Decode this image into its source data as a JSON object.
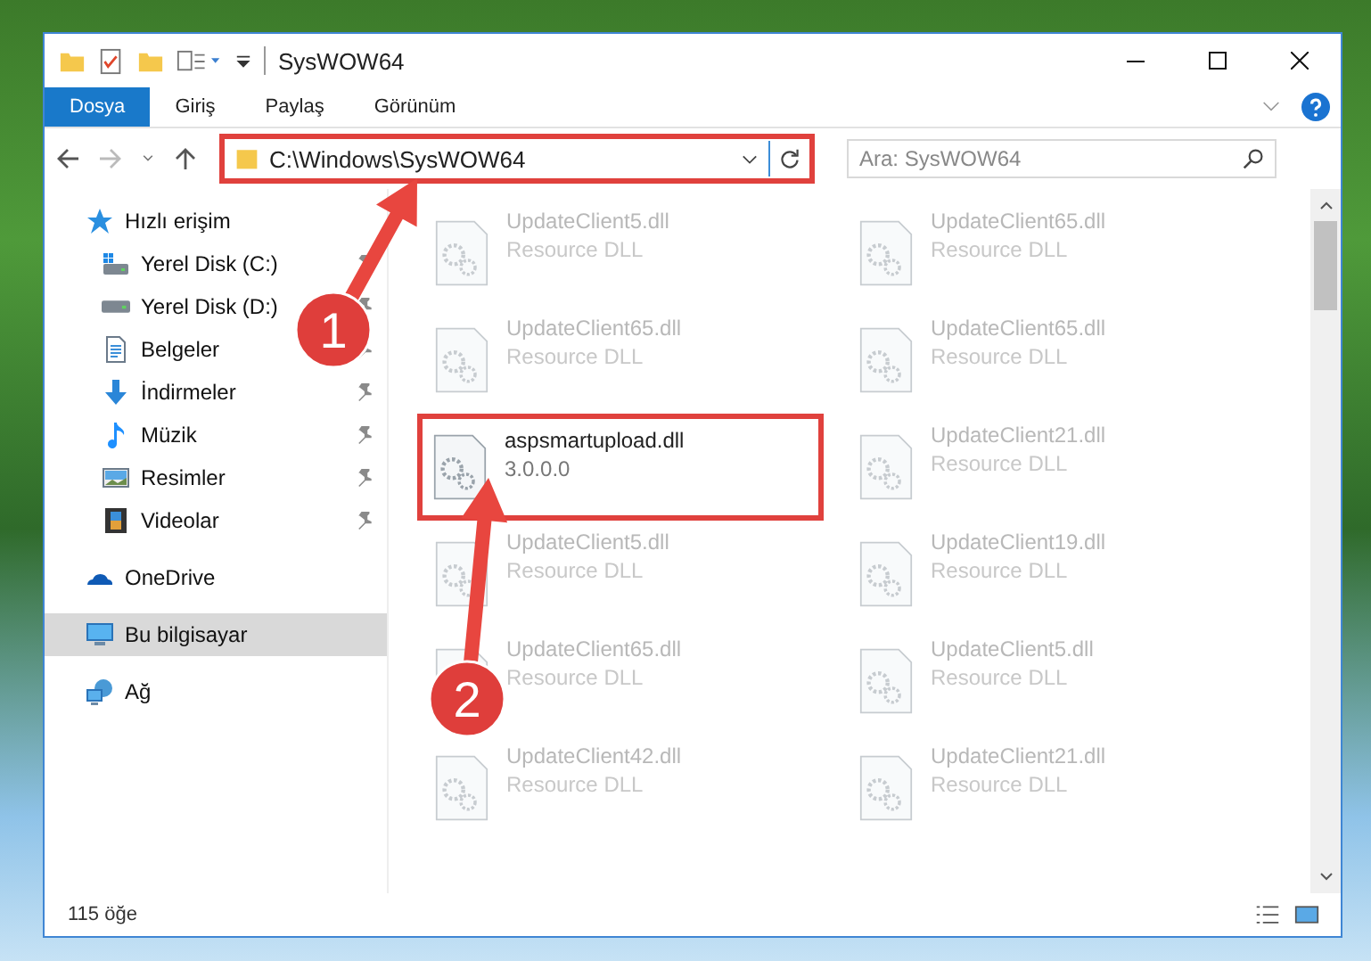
{
  "window": {
    "title": "SysWOW64"
  },
  "ribbon_tabs": [
    {
      "label": "Dosya",
      "selected": true
    },
    {
      "label": "Giriş",
      "selected": false
    },
    {
      "label": "Paylaş",
      "selected": false
    },
    {
      "label": "Görünüm",
      "selected": false
    }
  ],
  "address_bar": {
    "path": "C:\\Windows\\SysWOW64",
    "highlighted": true
  },
  "search": {
    "placeholder": "Ara: SysWOW64"
  },
  "sidebar": {
    "items": [
      {
        "label": "Hızlı erişim",
        "selected": false,
        "children": [
          {
            "label": "Yerel Disk (C:)",
            "pinned": true
          },
          {
            "label": "Yerel Disk (D:)",
            "pinned": true
          },
          {
            "label": "Belgeler",
            "pinned": true
          },
          {
            "label": "İndirmeler",
            "pinned": true
          },
          {
            "label": "Müzik",
            "pinned": true
          },
          {
            "label": "Resimler",
            "pinned": true
          },
          {
            "label": "Videolar",
            "pinned": true
          }
        ]
      },
      {
        "label": "OneDrive",
        "selected": false
      },
      {
        "label": "Bu bilgisayar",
        "selected": true
      },
      {
        "label": "Ağ",
        "selected": false
      }
    ]
  },
  "files": [
    {
      "name": "UpdateClient5.dll",
      "description": "Resource DLL",
      "highlighted": false
    },
    {
      "name": "UpdateClient65.dll",
      "description": "Resource DLL",
      "highlighted": false
    },
    {
      "name": "UpdateClient65.dll",
      "description": "Resource DLL",
      "highlighted": false
    },
    {
      "name": "UpdateClient65.dll",
      "description": "Resource DLL",
      "highlighted": false
    },
    {
      "name": "aspsmartupload.dll",
      "description": "3.0.0.0",
      "highlighted": true
    },
    {
      "name": "UpdateClient21.dll",
      "description": "Resource DLL",
      "highlighted": false
    },
    {
      "name": "UpdateClient5.dll",
      "description": "Resource DLL",
      "highlighted": false
    },
    {
      "name": "UpdateClient19.dll",
      "description": "Resource DLL",
      "highlighted": false
    },
    {
      "name": "UpdateClient65.dll",
      "description": "Resource DLL",
      "highlighted": false
    },
    {
      "name": "UpdateClient5.dll",
      "description": "Resource DLL",
      "highlighted": false
    },
    {
      "name": "UpdateClient42.dll",
      "description": "Resource DLL",
      "highlighted": false
    },
    {
      "name": "UpdateClient21.dll",
      "description": "Resource DLL",
      "highlighted": false
    }
  ],
  "status_bar": {
    "item_count": "115 öğe"
  },
  "annotations": [
    {
      "label": "1"
    },
    {
      "label": "2"
    }
  ]
}
